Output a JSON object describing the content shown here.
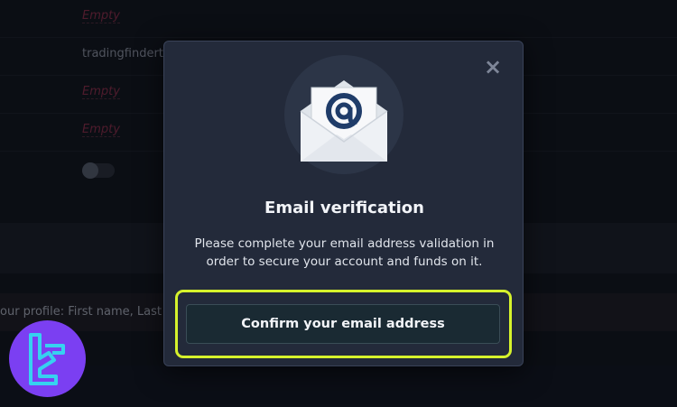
{
  "background": {
    "rows": [
      {
        "value": "Empty",
        "empty": true
      },
      {
        "value": "tradingfindert",
        "empty": false
      },
      {
        "value": "Empty",
        "empty": true
      },
      {
        "value": "Empty",
        "empty": true
      }
    ],
    "profile_notice": "our profile: First name, Last"
  },
  "modal": {
    "close_icon": "close-icon",
    "icon": "email-envelope-icon",
    "title": "Email verification",
    "description": "Please complete your email address validation in order to secure your account and funds on it.",
    "confirm_label": "Confirm your email address",
    "highlight_color": "#d6f22c"
  },
  "watermark": {
    "icon": "tradingfinder-logo-icon",
    "color": "#7b3ff2"
  }
}
